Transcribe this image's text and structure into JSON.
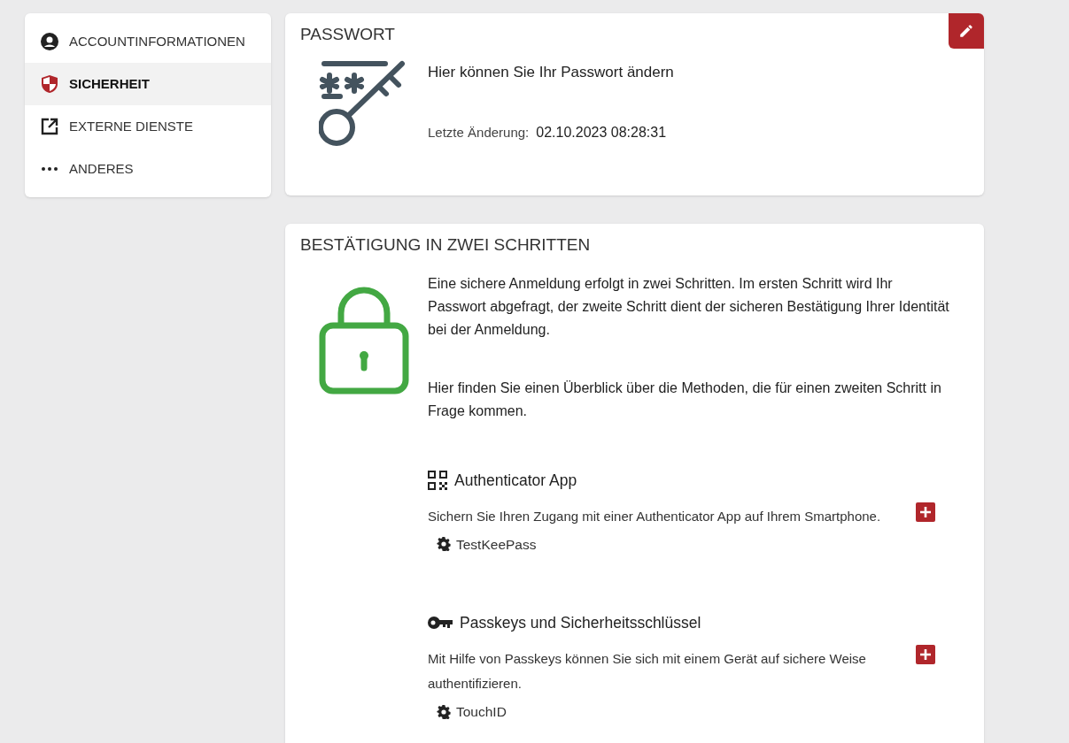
{
  "sidebar": {
    "items": [
      {
        "label": "ACCOUNTINFORMATIONEN",
        "kind": "account",
        "selected": false
      },
      {
        "label": "SICHERHEIT",
        "kind": "shield",
        "selected": true
      },
      {
        "label": "EXTERNE DIENSTE",
        "kind": "external",
        "selected": false
      },
      {
        "label": "ANDERES",
        "kind": "more",
        "selected": false
      }
    ]
  },
  "password": {
    "title": "PASSWORT",
    "description": "Hier können Sie Ihr Passwort ändern",
    "last_changed_label": "Letzte Änderung:",
    "last_changed_value": "02.10.2023 08:28:31"
  },
  "two_step": {
    "title": "BESTÄTIGUNG IN ZWEI SCHRITTEN",
    "paragraphs": [
      "Eine sichere Anmeldung erfolgt in zwei Schritten. Im ersten Schritt wird Ihr Passwort abgefragt, der zweite Schritt dient der sicheren Bestätigung Ihrer Identität bei der Anmeldung.",
      "Hier finden Sie einen Überblick über die Methoden, die für einen zweiten Schritt in Frage kommen."
    ],
    "methods": [
      {
        "kind": "qr",
        "title": "Authenticator App",
        "description": "Sichern Sie Ihren Zugang mit einer Authenticator App auf Ihrem Smartphone.",
        "entries": [
          "TestKeePass"
        ]
      },
      {
        "kind": "key",
        "title": "Passkeys und Sicherheitsschlüssel",
        "description": "Mit Hilfe von Passkeys können Sie sich mit einem Gerät auf sichere Weise authentifizieren.",
        "entries": [
          "TouchID"
        ]
      }
    ]
  }
}
